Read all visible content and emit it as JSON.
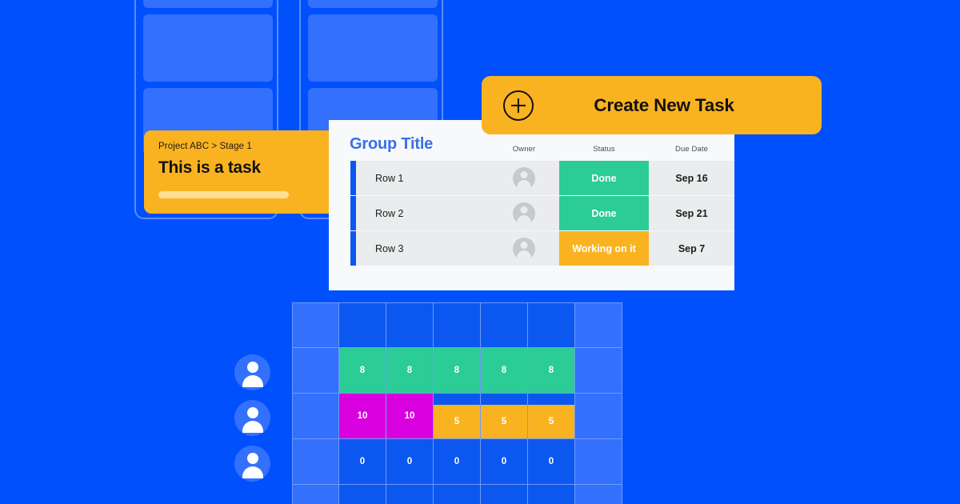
{
  "background_color": "#0050fe",
  "kanban": {
    "columns": [
      {
        "name": "column-1",
        "cards": [
          "card-1",
          "card-2"
        ]
      },
      {
        "name": "column-2",
        "cards": [
          "card-1",
          "card-2"
        ]
      }
    ]
  },
  "task_card": {
    "breadcrumb": "Project ABC > Stage 1",
    "title": "This is a task",
    "background_color": "#fab320",
    "progress_bar_color": "#ffdf94"
  },
  "create_task_button": {
    "label": "Create New Task",
    "icon": "plus-circle-icon",
    "background_color": "#fab320",
    "text_color": "#14110c"
  },
  "table": {
    "group_title": "Group Title",
    "group_title_color": "#3b6fe8",
    "columns": [
      "Owner",
      "Status",
      "Due Date"
    ],
    "rows": [
      {
        "name": "Row 1",
        "owner": "person-avatar",
        "status": "Done",
        "status_color": "#2bcc96",
        "due_date": "Sep 16"
      },
      {
        "name": "Row 2",
        "owner": "person-avatar",
        "status": "Done",
        "status_color": "#2bcc96",
        "due_date": "Sep 21"
      },
      {
        "name": "Row 3",
        "owner": "person-avatar",
        "status": "Working on it",
        "status_color": "#fab320",
        "due_date": "Sep 7"
      }
    ]
  },
  "chart_data": {
    "type": "heatmap",
    "title": "",
    "xlabel": "",
    "ylabel": "",
    "columns": 7,
    "rows": 5,
    "legend": [
      {
        "label": "8",
        "color": "#2bcc96"
      },
      {
        "label": "10",
        "color": "#d900e0"
      },
      {
        "label": "5",
        "color": "#fab320"
      },
      {
        "label": "0",
        "color": "#0b57f0"
      }
    ],
    "grid": true,
    "cells": [
      [
        {
          "value": "",
          "color": "#3370fc",
          "fill": "full"
        },
        {
          "value": "",
          "color": "#0b57f0",
          "fill": "none"
        },
        {
          "value": "",
          "color": "#0b57f0",
          "fill": "none"
        },
        {
          "value": "",
          "color": "#0b57f0",
          "fill": "none"
        },
        {
          "value": "",
          "color": "#0b57f0",
          "fill": "none"
        },
        {
          "value": "",
          "color": "#0b57f0",
          "fill": "none"
        },
        {
          "value": "",
          "color": "#3370fc",
          "fill": "full"
        }
      ],
      [
        {
          "value": "",
          "color": "#3370fc",
          "fill": "full"
        },
        {
          "value": "8",
          "color": "#2bcc96",
          "fill": "full"
        },
        {
          "value": "8",
          "color": "#2bcc96",
          "fill": "full"
        },
        {
          "value": "8",
          "color": "#2bcc96",
          "fill": "full"
        },
        {
          "value": "8",
          "color": "#2bcc96",
          "fill": "full"
        },
        {
          "value": "8",
          "color": "#2bcc96",
          "fill": "full"
        },
        {
          "value": "",
          "color": "#3370fc",
          "fill": "full"
        }
      ],
      [
        {
          "value": "",
          "color": "#3370fc",
          "fill": "full"
        },
        {
          "value": "10",
          "color": "#d900e0",
          "fill": "full"
        },
        {
          "value": "10",
          "color": "#d900e0",
          "fill": "full"
        },
        {
          "value": "5",
          "color": "#fab320",
          "fill": "p75"
        },
        {
          "value": "5",
          "color": "#fab320",
          "fill": "p75"
        },
        {
          "value": "5",
          "color": "#fab320",
          "fill": "p75"
        },
        {
          "value": "",
          "color": "#3370fc",
          "fill": "full"
        }
      ],
      [
        {
          "value": "",
          "color": "#3370fc",
          "fill": "full"
        },
        {
          "value": "0",
          "color": "#0b57f0",
          "fill": "none"
        },
        {
          "value": "0",
          "color": "#0b57f0",
          "fill": "none"
        },
        {
          "value": "0",
          "color": "#0b57f0",
          "fill": "none"
        },
        {
          "value": "0",
          "color": "#0b57f0",
          "fill": "none"
        },
        {
          "value": "0",
          "color": "#0b57f0",
          "fill": "none"
        },
        {
          "value": "",
          "color": "#3370fc",
          "fill": "full"
        }
      ],
      [
        {
          "value": "",
          "color": "#3370fc",
          "fill": "full"
        },
        {
          "value": "",
          "color": "#0b57f0",
          "fill": "none"
        },
        {
          "value": "",
          "color": "#0b57f0",
          "fill": "none"
        },
        {
          "value": "",
          "color": "#0b57f0",
          "fill": "none"
        },
        {
          "value": "",
          "color": "#0b57f0",
          "fill": "none"
        },
        {
          "value": "",
          "color": "#0b57f0",
          "fill": "none"
        },
        {
          "value": "",
          "color": "#3370fc",
          "fill": "full"
        }
      ]
    ],
    "row_avatars": [
      "person-avatar",
      "person-avatar",
      "person-avatar"
    ]
  }
}
